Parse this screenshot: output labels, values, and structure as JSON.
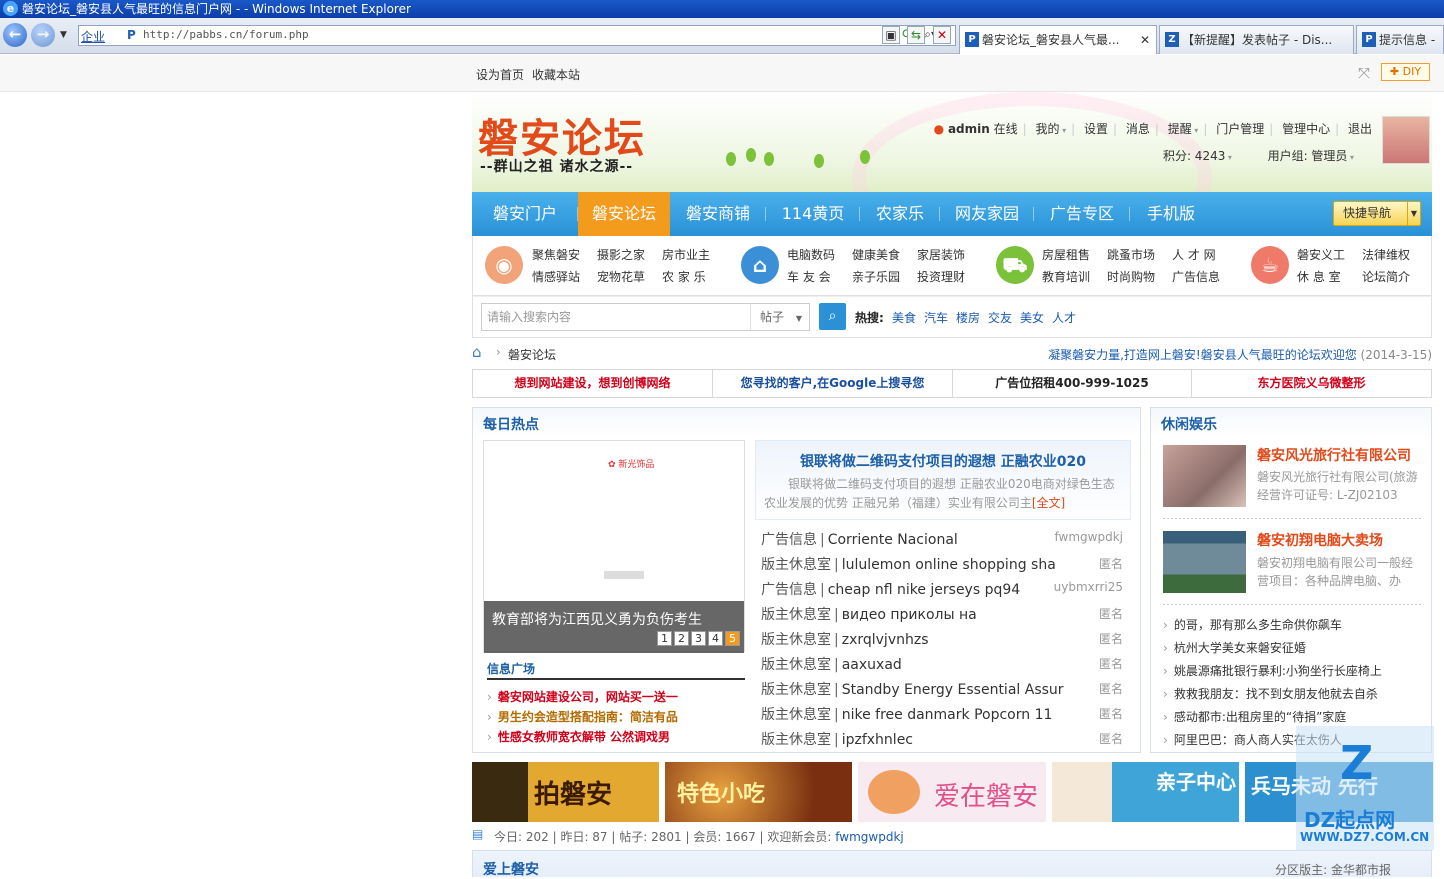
{
  "window": {
    "title": "磐安论坛_磐安县人气最旺的信息门户网 - - Windows Internet Explorer"
  },
  "browser": {
    "mode_label": "企业",
    "url": "http://pabbs.cn/forum.php",
    "tabs": [
      {
        "label": "磐安论坛_磐安县人气最..."
      },
      {
        "label": "【新提醒】发表帖子 - Dis..."
      },
      {
        "label": "提示信息 -"
      }
    ]
  },
  "topbar": {
    "set_home": "设为首页",
    "bookmark": "收藏本站",
    "diy": "DIY"
  },
  "header": {
    "logo": "磐安论坛",
    "slogan": "--群山之祖  诸水之源--",
    "user": {
      "name": "admin",
      "status": "在线",
      "links": [
        "我的",
        "设置",
        "消息",
        "提醒",
        "门户管理",
        "管理中心",
        "退出"
      ],
      "points": "积分: 4243",
      "group": "用户组: 管理员"
    }
  },
  "mainnav": {
    "items": [
      "磐安门户",
      "磐安论坛",
      "磐安商铺",
      "114黄页",
      "农家乐",
      "网友家园",
      "广告专区",
      "手机版"
    ],
    "quick": "快捷导航"
  },
  "subnav": {
    "groups": [
      {
        "icon": "chat-icon",
        "items": [
          "聚焦磐安",
          "摄影之家",
          "房市业主",
          "情感驿站",
          "宠物花草",
          "农 家 乐"
        ]
      },
      {
        "icon": "house-icon",
        "items": [
          "电脑数码",
          "健康美食",
          "家居装饰",
          "车 友 会",
          "亲子乐园",
          "投资理财"
        ]
      },
      {
        "icon": "cart-icon",
        "items": [
          "房屋租售",
          "跳蚤市场",
          "人 才 网",
          "教育培训",
          "时尚购物",
          "广告信息"
        ]
      },
      {
        "icon": "cup-icon",
        "items": [
          "磐安义工",
          "法律维权",
          "休 息 室",
          "论坛简介"
        ]
      }
    ]
  },
  "search": {
    "placeholder": "请输入搜索内容",
    "type": "帖子",
    "hot_label": "热搜:",
    "hot": [
      "美食",
      "汽车",
      "楼房",
      "交友",
      "美女",
      "人才"
    ]
  },
  "breadcrumb": {
    "current": "磐安论坛",
    "notice": "凝聚磐安力量,打造网上磐安!磐安县人气最旺的论坛欢迎您",
    "date": "(2014-3-15)"
  },
  "adbar": [
    {
      "text": "想到网站建设，想到创博网络",
      "color": "#d0021b"
    },
    {
      "text": "您寻找的客户,在Google上搜寻您",
      "color": "#1a4fa0"
    },
    {
      "text": "广告位招租400-999-1025",
      "color": "#222222"
    },
    {
      "text": "东方医院义乌微整形",
      "color": "#d0021b"
    }
  ],
  "daily": {
    "title": "每日热点",
    "slide_caption": "教育部将为江西见义勇为负伤考生",
    "slide_pages": [
      "1",
      "2",
      "3",
      "4",
      "5"
    ],
    "info_title": "信息广场",
    "info_items": [
      {
        "text": "磐安网站建设公司，网站买一送一",
        "color": "#d0021b"
      },
      {
        "text": "男生约会造型搭配指南：简洁有品",
        "color": "#b36b00"
      },
      {
        "text": "性感女教师宽衣解带 公然调戏男",
        "color": "#d0021b"
      }
    ],
    "headline": {
      "title": "银联将做二维码支付项目的遐想 正融农业020",
      "desc": "银联将做二维码支付项目的遐想 正融农业020电商对绿色生态农业发展的优势 正融兄弟（福建）实业有限公司主",
      "more": "[全文]"
    },
    "posts": [
      {
        "cat": "广告信息",
        "title": "Corriente Nacional",
        "author": "fwmgwpdkj"
      },
      {
        "cat": "版主休息室",
        "title": "lululemon online shopping sha",
        "author": "匿名"
      },
      {
        "cat": "广告信息",
        "title": "cheap nfl nike jerseys pq94",
        "author": "uybmxrri25"
      },
      {
        "cat": "版主休息室",
        "title": "видео приколы на",
        "author": "匿名"
      },
      {
        "cat": "版主休息室",
        "title": "zxrqlvjvnhzs",
        "author": "匿名"
      },
      {
        "cat": "版主休息室",
        "title": "aaxuxad",
        "author": "匿名"
      },
      {
        "cat": "版主休息室",
        "title": "Standby Energy Essential Assur",
        "author": "匿名"
      },
      {
        "cat": "版主休息室",
        "title": "nike free danmark Popcorn 11",
        "author": "匿名"
      },
      {
        "cat": "版主休息室",
        "title": "ipzfxhnlec",
        "author": "匿名"
      }
    ]
  },
  "leisure": {
    "title": "休闲娱乐",
    "features": [
      {
        "title": "磐安风光旅行社有限公司",
        "desc": "磐安风光旅行社有限公司(旅游经营许可证号: L-ZJ02103"
      },
      {
        "title": "磐安初翔电脑大卖场",
        "desc": "磐安初翔电脑有限公司一般经营项目：各种品牌电脑、办"
      }
    ],
    "items": [
      "的哥，那有那么多生命供你飙车",
      "杭州大学美女来磐安征婚",
      "姚晨源痛批银行暴利:小狗坐行长座椅上",
      "救救我朋友：找不到女朋友他就去自杀",
      "感动都市:出租房里的“待捐”家庭",
      "阿里巴巴：商人商人实在太伤人"
    ]
  },
  "banners": [
    {
      "text": "拍磐安",
      "bg": "#d9a020"
    },
    {
      "text": "特色小吃",
      "bg": "#a0451a"
    },
    {
      "text": "爱在磐安",
      "bg": "#f5e8ef"
    },
    {
      "text": "亲子中心",
      "bg": "#3fa4d8"
    },
    {
      "text": "兵马未动 先行",
      "bg": "#2b8fd0"
    }
  ],
  "stats": {
    "today": "今日: 202",
    "yesterday": "昨日: 87",
    "posts": "帖子: 2801",
    "members": "会员: 1667",
    "welcome": "欢迎新会员:",
    "newest": "fwmgwpdkj"
  },
  "section": {
    "title": "爱上磐安",
    "moderator": "分区版主: 金华都市报"
  },
  "watermark": {
    "logo": "Z",
    "site": "DZ起点网",
    "url": "WWW.DZ7.COM.CN"
  }
}
